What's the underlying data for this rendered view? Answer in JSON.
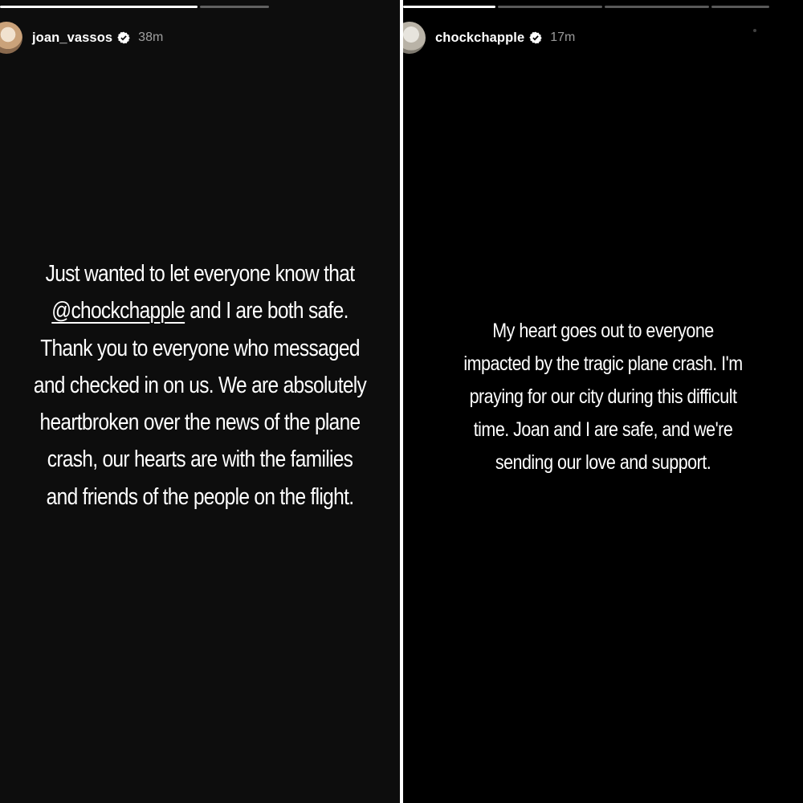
{
  "colors": {
    "left_background": "#0d0d0d",
    "right_background": "#000000",
    "divider": "#ffffff",
    "text": "#ffffff"
  },
  "stories": {
    "left": {
      "progress": [
        1.0,
        0.0
      ],
      "username": "joan_vassos",
      "verified_icon": "verified-badge-icon",
      "time": "38m",
      "caption": {
        "line1": "Just wanted to let everyone know that",
        "mention": "@chockchapple",
        "line2_rest": " and I are both safe.",
        "line3": "Thank you to everyone who messaged",
        "line4": "and checked in on us. We are absolutely",
        "line5": "heartbroken over the news of the plane",
        "line6": "crash, our hearts are with the families",
        "line7": "and friends of the people on the flight."
      }
    },
    "right": {
      "progress": [
        1.0,
        0.0,
        0.0,
        0.0
      ],
      "username": "chockchapple",
      "verified_icon": "verified-badge-icon",
      "time": "17m",
      "caption": {
        "line1": "My heart goes out to everyone",
        "line2": "impacted by the tragic plane crash. I'm",
        "line3": "praying for our city during this difficult",
        "line4": "time. Joan and I are safe, and we're",
        "line5": "sending our love and support."
      }
    }
  }
}
